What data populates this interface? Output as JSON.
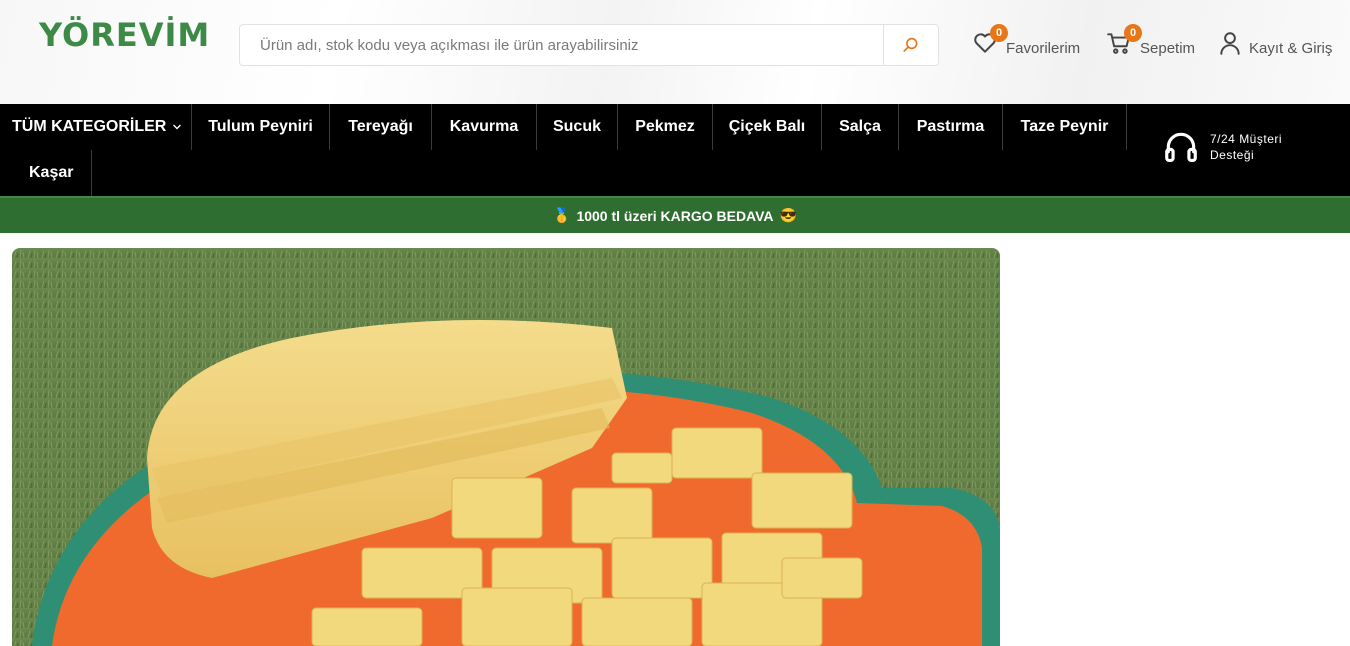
{
  "brand": {
    "logo_text": "YÖREVİM",
    "logo_color": "#3d8a47"
  },
  "search": {
    "placeholder": "Ürün adı, stok kodu veya açıkması ile ürün arayabilirsiniz",
    "value": "",
    "icon": "search-icon"
  },
  "header_actions": {
    "favorites": {
      "label": "Favorilerim",
      "count": "0",
      "icon": "heart-icon"
    },
    "cart": {
      "label": "Sepetim",
      "count": "0",
      "icon": "cart-icon"
    },
    "account": {
      "label": "Kayıt & Giriş",
      "icon": "user-icon"
    }
  },
  "nav": {
    "all_categories": "TÜM KATEGORİLER",
    "items": [
      "Tulum Peyniri",
      "Tereyağı",
      "Kavurma",
      "Sucuk",
      "Pekmez",
      "Çiçek Balı",
      "Salça",
      "Pastırma",
      "Taze Peynir",
      "Kaşar"
    ],
    "support_line1": "7/24 Müşteri",
    "support_line2": "Desteği",
    "support_icon": "headphones-icon"
  },
  "promo": {
    "text": "1000 tl üzeri KARGO BEDAVA",
    "left_emoji": "🥇",
    "right_emoji": "😎",
    "bg_color": "#2e6e30"
  },
  "colors": {
    "accent": "#e8771a",
    "nav_bg": "#000000"
  }
}
